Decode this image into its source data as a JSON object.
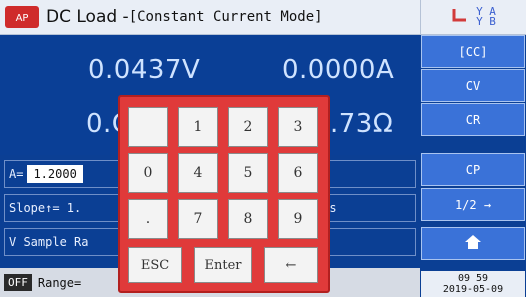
{
  "header": {
    "title": "DC Load - ",
    "mode": "[Constant Current Mode]",
    "status_icon": "battery-signal-icon",
    "status_text_line1": "Y A",
    "status_text_line2": "Y B"
  },
  "readings": {
    "voltage": "0.0437V",
    "current": "0.0000A",
    "power_partial": "0.C",
    "resistance_partial": ".73Ω"
  },
  "info": {
    "amp_label": "A=",
    "amp_value": "1.2000",
    "slope_label": "Slope↑= 1.",
    "slope_rate": "20A/us",
    "sample_label": "V Sample Ra"
  },
  "bottom": {
    "off_badge": "OFF",
    "range_label": "Range="
  },
  "side": {
    "buttons": [
      "[CC]",
      "CV",
      "CR",
      "CP",
      "1/2  →"
    ],
    "home_icon": "home-icon",
    "time": "09 59",
    "date": "2019-05-09"
  },
  "keypad": {
    "keys_row1": [
      "",
      "1",
      "2",
      "3"
    ],
    "keys_row2": [
      "0",
      "4",
      "5",
      "6"
    ],
    "keys_row3": [
      ".",
      "7",
      "8",
      "9"
    ],
    "esc": "ESC",
    "enter": "Enter",
    "backspace": "←"
  },
  "colors": {
    "background": "#0b3f94",
    "keypad": "#e03a3a",
    "side_button": "#3a72d8"
  }
}
